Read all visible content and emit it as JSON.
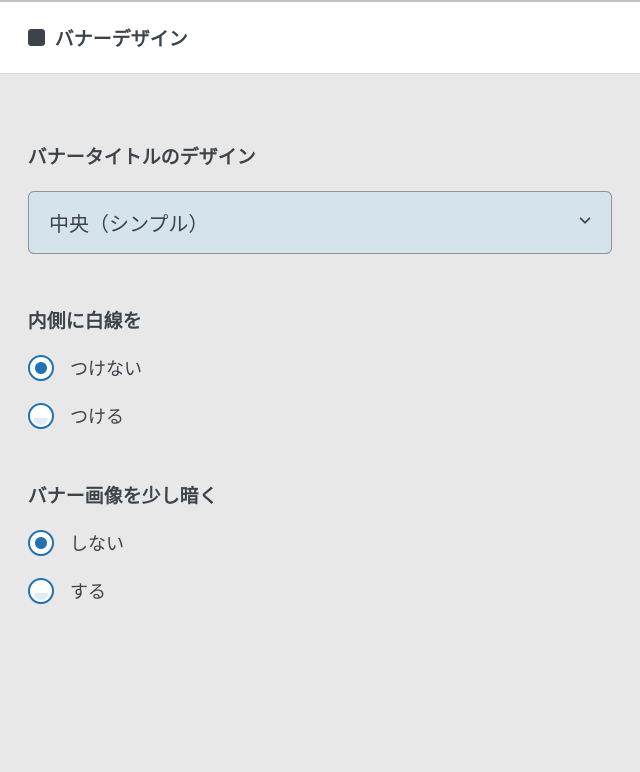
{
  "panel": {
    "title": "バナーデザイン",
    "icon_name": "square-icon"
  },
  "section_title_design": {
    "label": "バナータイトルのデザイン",
    "selected": "中央（シンプル）"
  },
  "section_inner_line": {
    "label": "内側に白線を",
    "options": [
      {
        "label": "つけない",
        "checked": true
      },
      {
        "label": "つける",
        "checked": false
      }
    ]
  },
  "section_darken": {
    "label": "バナー画像を少し暗く",
    "options": [
      {
        "label": "しない",
        "checked": true
      },
      {
        "label": "する",
        "checked": false
      }
    ]
  }
}
